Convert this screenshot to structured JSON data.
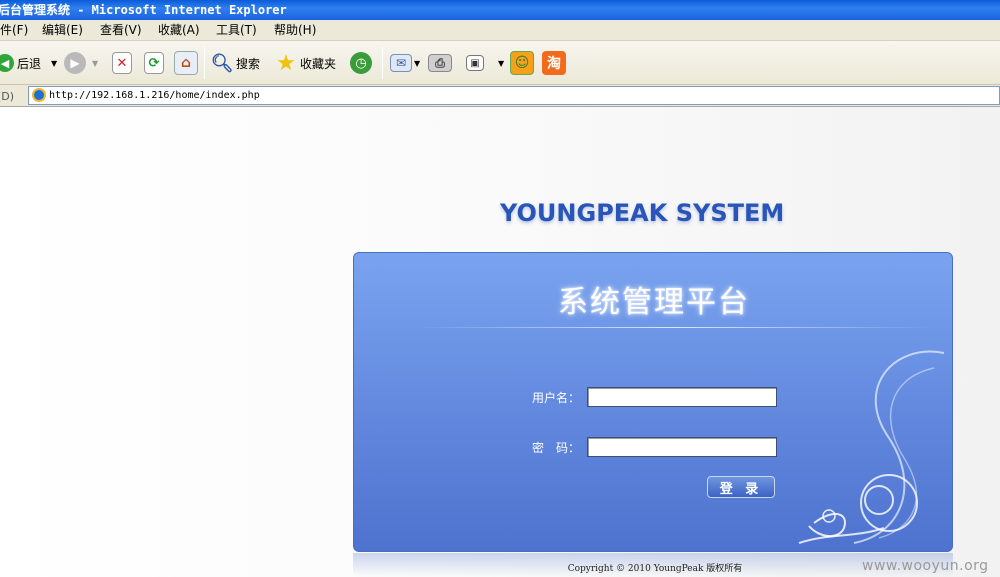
{
  "window": {
    "title": "后台管理系统 - Microsoft Internet Explorer"
  },
  "menu": {
    "items": [
      "文件(F)",
      "编辑(E)",
      "查看(V)",
      "收藏(A)",
      "工具(T)",
      "帮助(H)"
    ],
    "visible_labels": [
      "件(F)",
      "编辑(E)",
      "查看(V)",
      "收藏(A)",
      "工具(T)",
      "帮助(H)"
    ]
  },
  "toolbar": {
    "back_label": "后退",
    "search_label": "搜索",
    "favorites_label": "收藏夹"
  },
  "address": {
    "label": "址(D)",
    "url": "http://192.168.1.216/home/index.php"
  },
  "page": {
    "brand": "YOUNGPEAK SYSTEM",
    "panel_title": "系统管理平台",
    "username_label": "用户名：",
    "password_label": "密　码：",
    "username_value": "",
    "password_value": "",
    "login_button": "登 录",
    "copyright": "Copyright © 2010 YoungPeak 版权所有"
  },
  "watermark": "www.wooyun.org",
  "colors": {
    "titlebar": "#0a5bd8",
    "panel": "#6d95e6",
    "brand": "#2a55b8"
  }
}
